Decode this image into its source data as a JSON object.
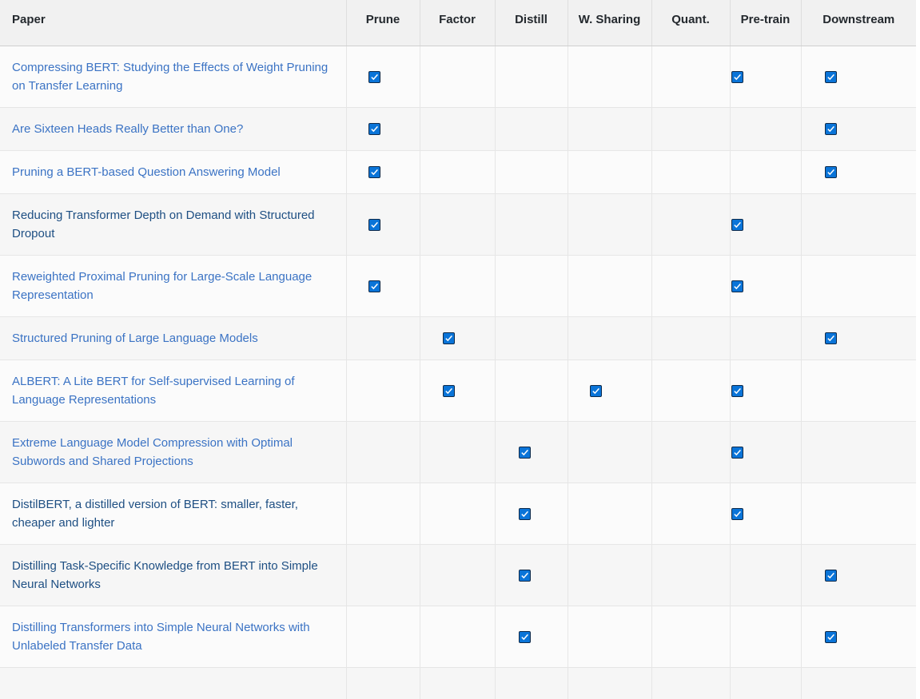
{
  "table": {
    "headers": {
      "paper": "Paper",
      "prune": "Prune",
      "factor": "Factor",
      "distill": "Distill",
      "weight_sharing": "W. Sharing",
      "quant": "Quant.",
      "pretrain": "Pre-train",
      "downstream": "Downstream"
    },
    "rows": [
      {
        "title": "Compressing BERT: Studying the Effects of Weight Pruning on Transfer Learning",
        "prune": true,
        "factor": false,
        "distill": false,
        "weight_sharing": false,
        "quant": false,
        "pretrain": true,
        "downstream": true
      },
      {
        "title": "Are Sixteen Heads Really Better than One?",
        "prune": true,
        "factor": false,
        "distill": false,
        "weight_sharing": false,
        "quant": false,
        "pretrain": false,
        "downstream": true
      },
      {
        "title": "Pruning a BERT-based Question Answering Model",
        "prune": true,
        "factor": false,
        "distill": false,
        "weight_sharing": false,
        "quant": false,
        "pretrain": false,
        "downstream": true
      },
      {
        "title": "Reducing Transformer Depth on Demand with Structured Dropout",
        "prune": true,
        "factor": false,
        "distill": false,
        "weight_sharing": false,
        "quant": false,
        "pretrain": true,
        "downstream": false
      },
      {
        "title": "Reweighted Proximal Pruning for Large-Scale Language Representation",
        "prune": true,
        "factor": false,
        "distill": false,
        "weight_sharing": false,
        "quant": false,
        "pretrain": true,
        "downstream": false
      },
      {
        "title": "Structured Pruning of Large Language Models",
        "prune": false,
        "factor": true,
        "distill": false,
        "weight_sharing": false,
        "quant": false,
        "pretrain": false,
        "downstream": true
      },
      {
        "title": "ALBERT: A Lite BERT for Self-supervised Learning of Language Representations",
        "prune": false,
        "factor": true,
        "distill": false,
        "weight_sharing": true,
        "quant": false,
        "pretrain": true,
        "downstream": false
      },
      {
        "title": "Extreme Language Model Compression with Optimal Subwords and Shared Projections",
        "prune": false,
        "factor": false,
        "distill": true,
        "weight_sharing": false,
        "quant": false,
        "pretrain": true,
        "downstream": false
      },
      {
        "title": "DistilBERT, a distilled version of BERT: smaller, faster, cheaper and lighter",
        "prune": false,
        "factor": false,
        "distill": true,
        "weight_sharing": false,
        "quant": false,
        "pretrain": true,
        "downstream": false
      },
      {
        "title": "Distilling Task-Specific Knowledge from BERT into Simple Neural Networks",
        "prune": false,
        "factor": false,
        "distill": true,
        "weight_sharing": false,
        "quant": false,
        "pretrain": false,
        "downstream": true
      },
      {
        "title": "Distilling Transformers into Simple Neural Networks with Unlabeled Transfer Data",
        "prune": false,
        "factor": false,
        "distill": true,
        "weight_sharing": false,
        "quant": false,
        "pretrain": false,
        "downstream": true
      }
    ]
  },
  "icons": {
    "checked": "checkbox-checked-icon"
  },
  "colors": {
    "checkbox_fill": "#0a74d8",
    "link": "#3b73c4",
    "link_visited": "#1e4f83"
  }
}
